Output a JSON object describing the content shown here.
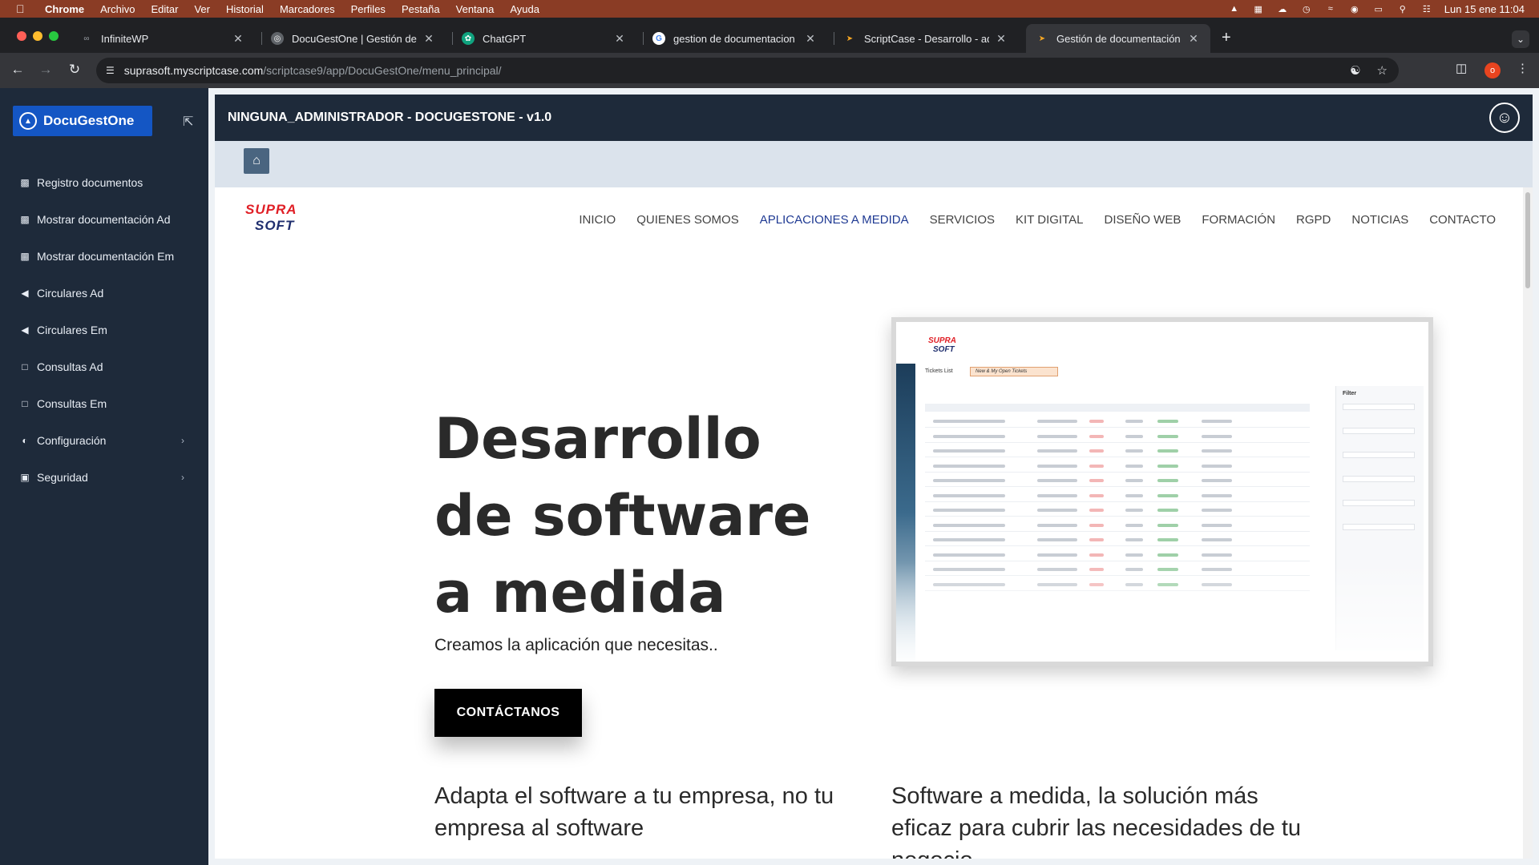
{
  "menubar": {
    "app": "Chrome",
    "items": [
      "Archivo",
      "Editar",
      "Ver",
      "Historial",
      "Marcadores",
      "Perfiles",
      "Pestaña",
      "Ventana",
      "Ayuda"
    ],
    "clock": "Lun 15 ene  11:04"
  },
  "tabs": [
    {
      "title": "InfiniteWP",
      "icon": "infinity-icon"
    },
    {
      "title": "DocuGestOne | Gestión de documentación",
      "icon": "globe-icon"
    },
    {
      "title": "ChatGPT",
      "icon": "chatgpt-icon"
    },
    {
      "title": "gestion de documentacion para",
      "icon": "google-icon"
    },
    {
      "title": "ScriptCase - Desarrollo - admin",
      "icon": "scriptcase-icon"
    },
    {
      "title": "Gestión de documentación",
      "icon": "scriptcase-icon"
    }
  ],
  "address": {
    "host": "suprasoft.myscriptcase.com",
    "path": "/scriptcase9/app/DocuGestOne/menu_principal/"
  },
  "profile_badge": "o",
  "sidebar": {
    "brand": "DocuGestOne",
    "items": [
      {
        "label": "Registro documentos",
        "icon": "document-icon",
        "has_submenu": false
      },
      {
        "label": "Mostrar documentación Ad",
        "icon": "document-icon",
        "has_submenu": false
      },
      {
        "label": "Mostrar documentación Em",
        "icon": "document-icon",
        "has_submenu": false
      },
      {
        "label": "Circulares Ad",
        "icon": "megaphone-icon",
        "has_submenu": false
      },
      {
        "label": "Circulares Em",
        "icon": "megaphone-icon",
        "has_submenu": false
      },
      {
        "label": "Consultas Ad",
        "icon": "chat-icon",
        "has_submenu": false
      },
      {
        "label": "Consultas Em",
        "icon": "chat-icon",
        "has_submenu": false
      },
      {
        "label": "Configuración",
        "icon": "contrast-icon",
        "has_submenu": true
      },
      {
        "label": "Seguridad",
        "icon": "lock-icon",
        "has_submenu": true
      }
    ]
  },
  "header": {
    "title": "NINGUNA_ADMINISTRADOR - DOCUGESTONE - v1.0"
  },
  "site": {
    "logo_top": "SUPRA",
    "logo_bottom": "SOFT",
    "nav": [
      "INICIO",
      "QUIENES SOMOS",
      "APLICACIONES A MEDIDA",
      "SERVICIOS",
      "KIT DIGITAL",
      "DISEÑO WEB",
      "FORMACIÓN",
      "RGPD",
      "NOTICIAS",
      "CONTACTO"
    ],
    "nav_active": "APLICACIONES A MEDIDA",
    "hero_title": "Desarrollo de software a medida",
    "hero_sub": "Creamos la aplicación que necesitas..",
    "cta": "CONTÁCTANOS",
    "screenshot": {
      "list_title": "Tickets List",
      "filter_chip": "New & My Open Tickets",
      "filter_label": "Filter"
    },
    "sub_left": "Adapta el software a tu empresa, no tu empresa al software",
    "sub_right": "Software a medida, la solución más eficaz para cubrir las necesidades de tu negocio"
  },
  "colors": {
    "sidebar_bg": "#1e2a3a",
    "brand_blue": "#1456c4",
    "nav_active": "#1f3a93",
    "menubar": "#8a3c25"
  }
}
